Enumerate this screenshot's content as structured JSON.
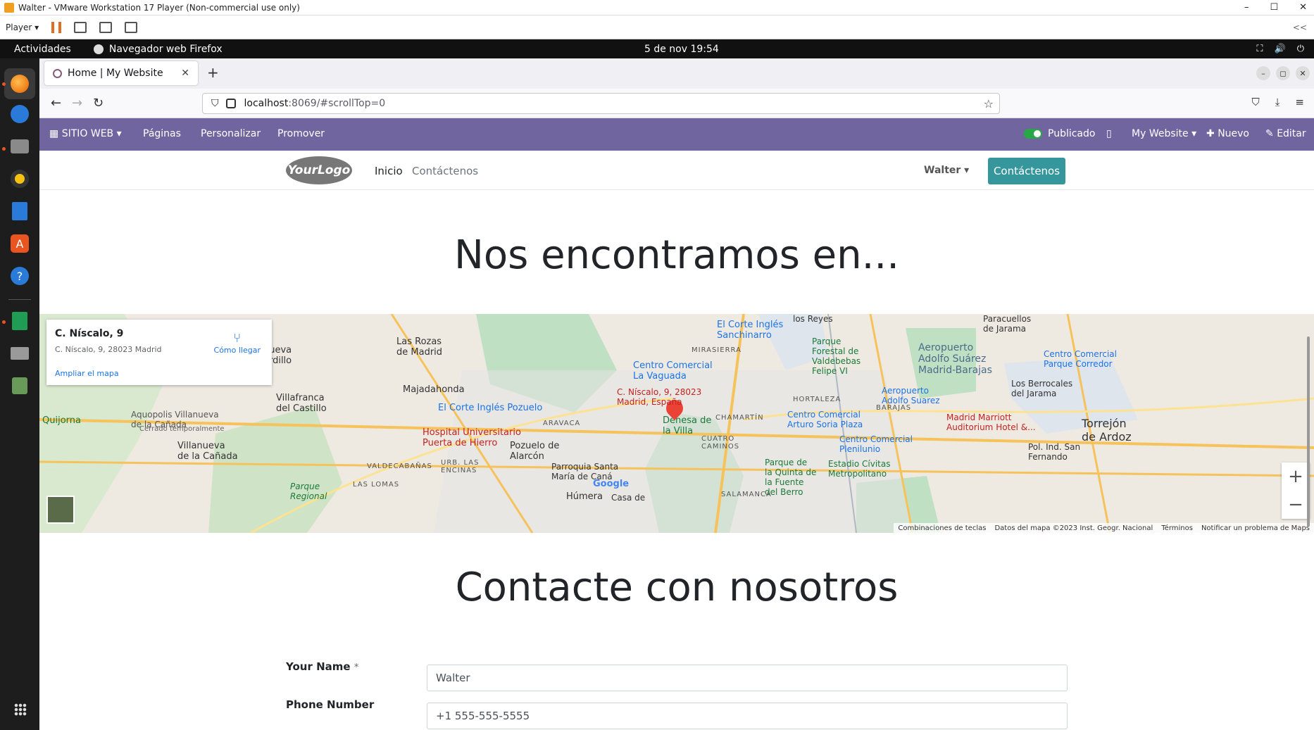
{
  "vmware": {
    "title": "Walter - VMware Workstation 17 Player (Non-commercial use only)",
    "player_label": "Player",
    "collapse_label": "<<"
  },
  "gnome": {
    "activities": "Actividades",
    "app_name": "Navegador web Firefox",
    "clock": "5 de nov  19:54"
  },
  "browser": {
    "tab_title": "Home | My Website",
    "url_host": "localhost",
    "url_rest": ":8069/#scrollTop=0"
  },
  "odoo_bar": {
    "website_menu": "SITIO WEB",
    "pages": "Páginas",
    "customize": "Personalizar",
    "promote": "Promover",
    "published": "Publicado",
    "website_switch": "My Website",
    "new": "Nuevo",
    "edit": "Editar"
  },
  "site": {
    "logo_text": "YourLogo",
    "nav_home": "Inicio",
    "nav_contact": "Contáctenos",
    "user": "Walter",
    "cta": "Contáctenos"
  },
  "main": {
    "heading_map": "Nos encontramos en...",
    "heading_contact": "Contacte con nosotros"
  },
  "map": {
    "card_name": "C. Níscalo, 9",
    "card_address": "C. Níscalo, 9, 28023 Madrid",
    "card_enlarge": "Ampliar el mapa",
    "card_directions": "Cómo llegar",
    "pin_label_1": "C. Níscalo, 9, 28023",
    "pin_label_2": "Madrid, España",
    "places": {
      "las_rozas": "Las Rozas\nde Madrid",
      "majadahonda": "Majadahonda",
      "villafranca": "Villafranca\ndel Castillo",
      "aquopolis": "Aquopolis Villanueva\nde la Cañada",
      "cerrado": "Cerrado temporalmente",
      "villanueva": "Villanueva\nde la Cañada",
      "quijorna": "Quijorna",
      "corte_pozuelo": "El Corte Inglés Pozuelo",
      "hospital": "Hospital Universitario\nPuerta de Hierro",
      "pozuelo": "Pozuelo de\nAlarcón",
      "aravaca": "ARAVACA",
      "valdecabanas": "VALDECABAÑAS",
      "las_lomas": "LAS LOMAS",
      "urb_encinas": "URB. LAS\nENCINAS",
      "parroquia": "Parroquia Santa\nMaría de Caná",
      "humera": "Húmera",
      "corte_sanchinarro": "El Corte Inglés\nSanchinarro",
      "vaguada": "Centro Comercial\nLa Vaguada",
      "mirasierra": "MIRASIERRA",
      "valdebebas": "Parque\nForestal de\nValdebebas\nFelipe VI",
      "hortaleza": "HORTALEZA",
      "chamartin": "CHAMARTÍN",
      "dehesa": "Dehesa de\nla Villa",
      "cuatro_caminos": "CUATRO\nCAMINOS",
      "arturo_soria": "Centro Comercial\nArturo Soria Plaza",
      "plenilunio": "Centro Comercial\nPlenilunio",
      "quinta_fuente": "Parque de\nla Quinta de\nla Fuente\ndel Berro",
      "metropolitano": "Estadio Cívitas\nMetropolitano",
      "salamanca": "SALAMANCA",
      "aeropuerto": "Aeropuerto\nAdolfo Suárez\nMadrid-Barajas",
      "aeropuerto_short": "Aeropuerto\nAdolfo Suarez",
      "barajas": "BARAJAS",
      "marriott": "Madrid Marriott\nAuditorium Hotel &...",
      "corredor": "Centro Comercial\nParque Corredor",
      "berrocales": "Los Berrocales\ndel Jarama",
      "torrejon": "Torrejón\nde Ardoz",
      "pol_san_fernando": "Pol. Ind. San\nFernando",
      "los_reyes": "los Reyes",
      "paracuellos": "Paracuellos\nde Jarama",
      "parque_regional": "Parque\nRegional",
      "casa_de": "Casa de",
      "nueva_ardillo": "nueva\nardillo"
    },
    "footer_shortcuts": "Combinaciones de teclas",
    "footer_data": "Datos del mapa ©2023 Inst. Geogr. Nacional",
    "footer_terms": "Términos",
    "footer_report": "Notificar un problema de Maps",
    "google": "Google"
  },
  "form": {
    "name_label": "Your Name",
    "name_required": "*",
    "name_value": "Walter",
    "phone_label": "Phone Number",
    "phone_value": "+1 555-555-5555"
  }
}
